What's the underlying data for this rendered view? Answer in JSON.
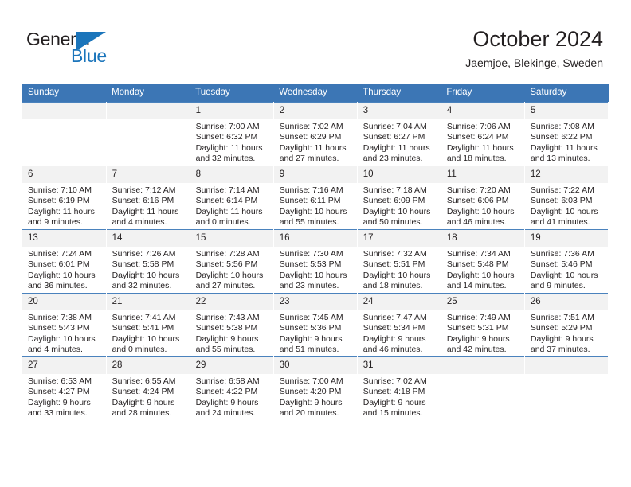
{
  "brand": {
    "name_part1": "General",
    "name_part2": "Blue",
    "logo_icon": "blue-flag-triangle-icon",
    "accent_color": "#1b75bb"
  },
  "header": {
    "title": "October 2024",
    "subtitle": "Jaemjoe, Blekinge, Sweden"
  },
  "calendar": {
    "header_bg": "#3c76b5",
    "daynum_bg": "#f2f2f2",
    "weekday_headers": [
      "Sunday",
      "Monday",
      "Tuesday",
      "Wednesday",
      "Thursday",
      "Friday",
      "Saturday"
    ],
    "weeks": [
      [
        {
          "day": "",
          "sunrise": "",
          "sunset": "",
          "daylight_line1": "",
          "daylight_line2": ""
        },
        {
          "day": "",
          "sunrise": "",
          "sunset": "",
          "daylight_line1": "",
          "daylight_line2": ""
        },
        {
          "day": "1",
          "sunrise": "Sunrise: 7:00 AM",
          "sunset": "Sunset: 6:32 PM",
          "daylight_line1": "Daylight: 11 hours",
          "daylight_line2": "and 32 minutes."
        },
        {
          "day": "2",
          "sunrise": "Sunrise: 7:02 AM",
          "sunset": "Sunset: 6:29 PM",
          "daylight_line1": "Daylight: 11 hours",
          "daylight_line2": "and 27 minutes."
        },
        {
          "day": "3",
          "sunrise": "Sunrise: 7:04 AM",
          "sunset": "Sunset: 6:27 PM",
          "daylight_line1": "Daylight: 11 hours",
          "daylight_line2": "and 23 minutes."
        },
        {
          "day": "4",
          "sunrise": "Sunrise: 7:06 AM",
          "sunset": "Sunset: 6:24 PM",
          "daylight_line1": "Daylight: 11 hours",
          "daylight_line2": "and 18 minutes."
        },
        {
          "day": "5",
          "sunrise": "Sunrise: 7:08 AM",
          "sunset": "Sunset: 6:22 PM",
          "daylight_line1": "Daylight: 11 hours",
          "daylight_line2": "and 13 minutes."
        }
      ],
      [
        {
          "day": "6",
          "sunrise": "Sunrise: 7:10 AM",
          "sunset": "Sunset: 6:19 PM",
          "daylight_line1": "Daylight: 11 hours",
          "daylight_line2": "and 9 minutes."
        },
        {
          "day": "7",
          "sunrise": "Sunrise: 7:12 AM",
          "sunset": "Sunset: 6:16 PM",
          "daylight_line1": "Daylight: 11 hours",
          "daylight_line2": "and 4 minutes."
        },
        {
          "day": "8",
          "sunrise": "Sunrise: 7:14 AM",
          "sunset": "Sunset: 6:14 PM",
          "daylight_line1": "Daylight: 11 hours",
          "daylight_line2": "and 0 minutes."
        },
        {
          "day": "9",
          "sunrise": "Sunrise: 7:16 AM",
          "sunset": "Sunset: 6:11 PM",
          "daylight_line1": "Daylight: 10 hours",
          "daylight_line2": "and 55 minutes."
        },
        {
          "day": "10",
          "sunrise": "Sunrise: 7:18 AM",
          "sunset": "Sunset: 6:09 PM",
          "daylight_line1": "Daylight: 10 hours",
          "daylight_line2": "and 50 minutes."
        },
        {
          "day": "11",
          "sunrise": "Sunrise: 7:20 AM",
          "sunset": "Sunset: 6:06 PM",
          "daylight_line1": "Daylight: 10 hours",
          "daylight_line2": "and 46 minutes."
        },
        {
          "day": "12",
          "sunrise": "Sunrise: 7:22 AM",
          "sunset": "Sunset: 6:03 PM",
          "daylight_line1": "Daylight: 10 hours",
          "daylight_line2": "and 41 minutes."
        }
      ],
      [
        {
          "day": "13",
          "sunrise": "Sunrise: 7:24 AM",
          "sunset": "Sunset: 6:01 PM",
          "daylight_line1": "Daylight: 10 hours",
          "daylight_line2": "and 36 minutes."
        },
        {
          "day": "14",
          "sunrise": "Sunrise: 7:26 AM",
          "sunset": "Sunset: 5:58 PM",
          "daylight_line1": "Daylight: 10 hours",
          "daylight_line2": "and 32 minutes."
        },
        {
          "day": "15",
          "sunrise": "Sunrise: 7:28 AM",
          "sunset": "Sunset: 5:56 PM",
          "daylight_line1": "Daylight: 10 hours",
          "daylight_line2": "and 27 minutes."
        },
        {
          "day": "16",
          "sunrise": "Sunrise: 7:30 AM",
          "sunset": "Sunset: 5:53 PM",
          "daylight_line1": "Daylight: 10 hours",
          "daylight_line2": "and 23 minutes."
        },
        {
          "day": "17",
          "sunrise": "Sunrise: 7:32 AM",
          "sunset": "Sunset: 5:51 PM",
          "daylight_line1": "Daylight: 10 hours",
          "daylight_line2": "and 18 minutes."
        },
        {
          "day": "18",
          "sunrise": "Sunrise: 7:34 AM",
          "sunset": "Sunset: 5:48 PM",
          "daylight_line1": "Daylight: 10 hours",
          "daylight_line2": "and 14 minutes."
        },
        {
          "day": "19",
          "sunrise": "Sunrise: 7:36 AM",
          "sunset": "Sunset: 5:46 PM",
          "daylight_line1": "Daylight: 10 hours",
          "daylight_line2": "and 9 minutes."
        }
      ],
      [
        {
          "day": "20",
          "sunrise": "Sunrise: 7:38 AM",
          "sunset": "Sunset: 5:43 PM",
          "daylight_line1": "Daylight: 10 hours",
          "daylight_line2": "and 4 minutes."
        },
        {
          "day": "21",
          "sunrise": "Sunrise: 7:41 AM",
          "sunset": "Sunset: 5:41 PM",
          "daylight_line1": "Daylight: 10 hours",
          "daylight_line2": "and 0 minutes."
        },
        {
          "day": "22",
          "sunrise": "Sunrise: 7:43 AM",
          "sunset": "Sunset: 5:38 PM",
          "daylight_line1": "Daylight: 9 hours",
          "daylight_line2": "and 55 minutes."
        },
        {
          "day": "23",
          "sunrise": "Sunrise: 7:45 AM",
          "sunset": "Sunset: 5:36 PM",
          "daylight_line1": "Daylight: 9 hours",
          "daylight_line2": "and 51 minutes."
        },
        {
          "day": "24",
          "sunrise": "Sunrise: 7:47 AM",
          "sunset": "Sunset: 5:34 PM",
          "daylight_line1": "Daylight: 9 hours",
          "daylight_line2": "and 46 minutes."
        },
        {
          "day": "25",
          "sunrise": "Sunrise: 7:49 AM",
          "sunset": "Sunset: 5:31 PM",
          "daylight_line1": "Daylight: 9 hours",
          "daylight_line2": "and 42 minutes."
        },
        {
          "day": "26",
          "sunrise": "Sunrise: 7:51 AM",
          "sunset": "Sunset: 5:29 PM",
          "daylight_line1": "Daylight: 9 hours",
          "daylight_line2": "and 37 minutes."
        }
      ],
      [
        {
          "day": "27",
          "sunrise": "Sunrise: 6:53 AM",
          "sunset": "Sunset: 4:27 PM",
          "daylight_line1": "Daylight: 9 hours",
          "daylight_line2": "and 33 minutes."
        },
        {
          "day": "28",
          "sunrise": "Sunrise: 6:55 AM",
          "sunset": "Sunset: 4:24 PM",
          "daylight_line1": "Daylight: 9 hours",
          "daylight_line2": "and 28 minutes."
        },
        {
          "day": "29",
          "sunrise": "Sunrise: 6:58 AM",
          "sunset": "Sunset: 4:22 PM",
          "daylight_line1": "Daylight: 9 hours",
          "daylight_line2": "and 24 minutes."
        },
        {
          "day": "30",
          "sunrise": "Sunrise: 7:00 AM",
          "sunset": "Sunset: 4:20 PM",
          "daylight_line1": "Daylight: 9 hours",
          "daylight_line2": "and 20 minutes."
        },
        {
          "day": "31",
          "sunrise": "Sunrise: 7:02 AM",
          "sunset": "Sunset: 4:18 PM",
          "daylight_line1": "Daylight: 9 hours",
          "daylight_line2": "and 15 minutes."
        },
        {
          "day": "",
          "sunrise": "",
          "sunset": "",
          "daylight_line1": "",
          "daylight_line2": ""
        },
        {
          "day": "",
          "sunrise": "",
          "sunset": "",
          "daylight_line1": "",
          "daylight_line2": ""
        }
      ]
    ]
  }
}
